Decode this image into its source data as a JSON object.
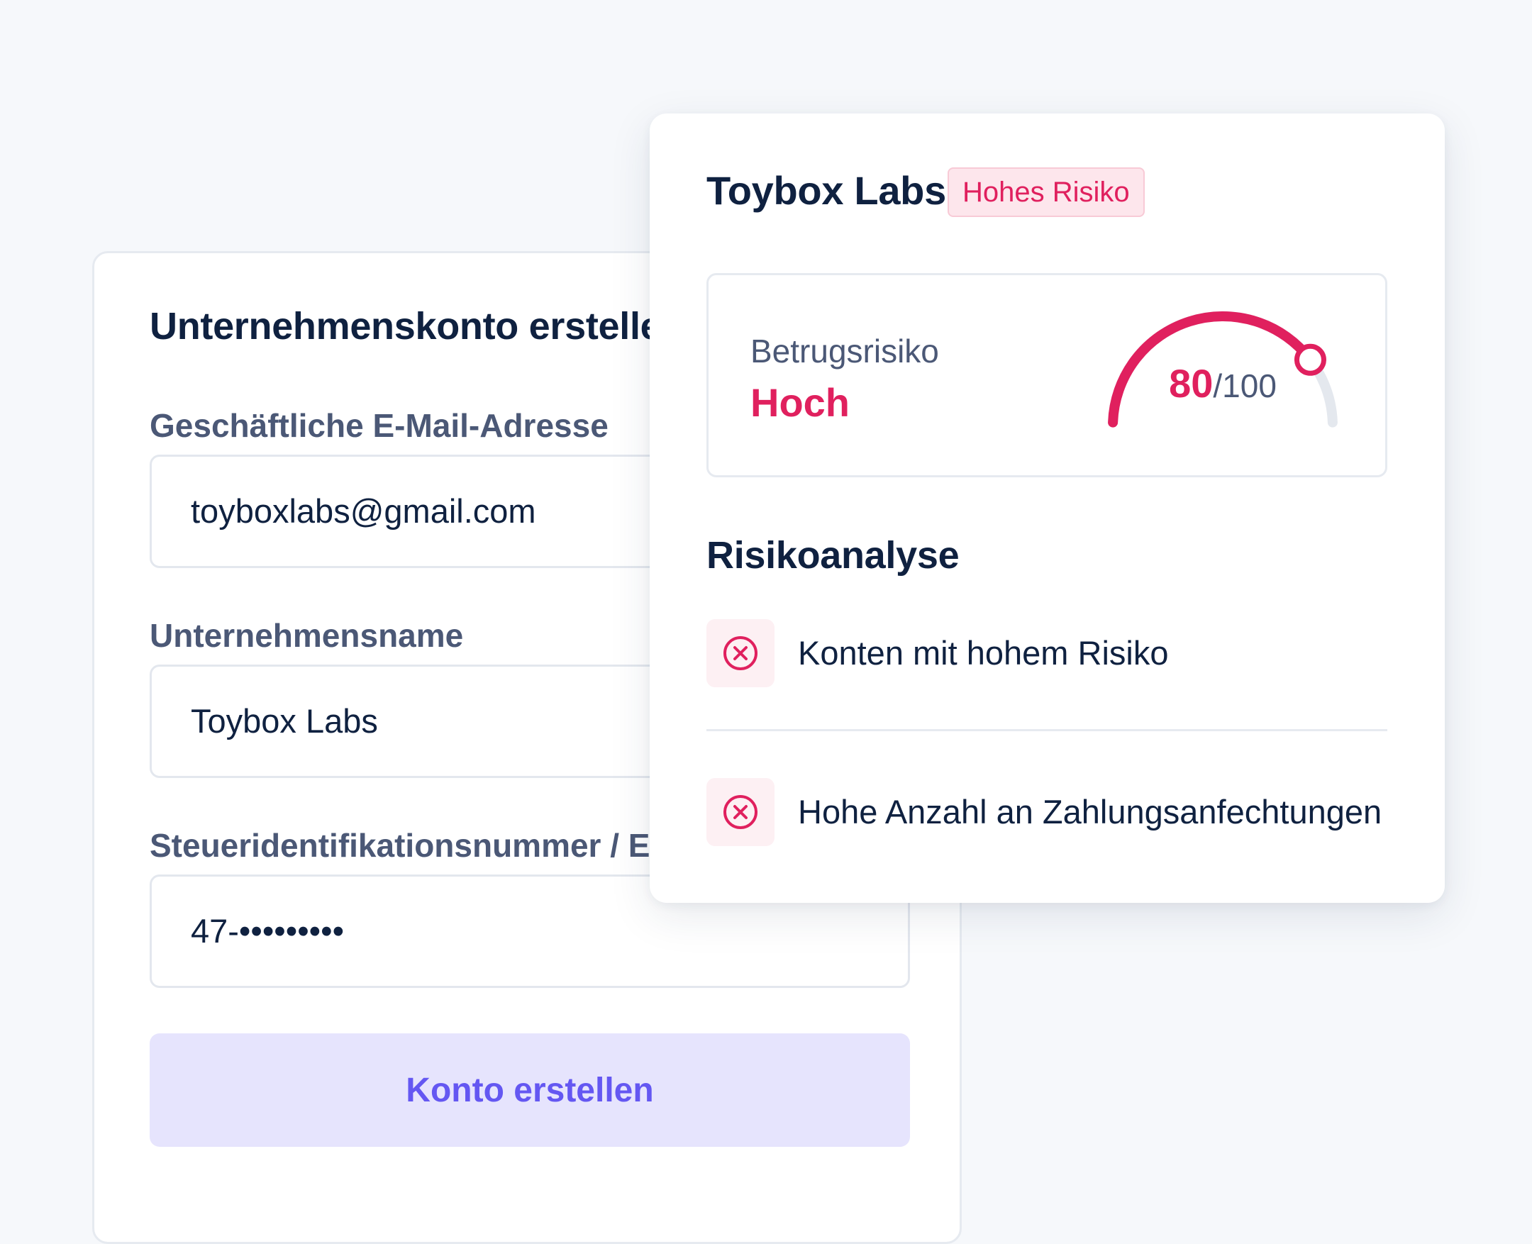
{
  "signup_form": {
    "title": "Unternehmenskonto erstellen",
    "email": {
      "label": "Geschäftliche E-Mail-Adresse",
      "value": "toyboxlabs@gmail.com"
    },
    "company_name": {
      "label": "Unternehmensname",
      "value": "Toybox Labs"
    },
    "tax_id": {
      "label": "Steueridentifikationsnummer / EIN",
      "value": "47-•••••••••"
    },
    "submit_label": "Konto erstellen"
  },
  "risk_card": {
    "company_name": "Toybox Labs",
    "badge": "Hohes Risiko",
    "score": {
      "label": "Betrugsrisiko",
      "level": "Hoch",
      "value": 80,
      "max_text": "/100",
      "max": 100
    },
    "analysis": {
      "title": "Risikoanalyse",
      "items": [
        {
          "text": "Konten mit hohem Risiko",
          "icon": "x-circle-icon"
        },
        {
          "text": "Hohe Anzahl an Zahlungsanfechtungen",
          "icon": "x-circle-icon"
        }
      ]
    }
  },
  "colors": {
    "background": "#f6f8fb",
    "danger": "#e0205e",
    "danger_soft": "#fde6ec",
    "primary": "#6457f2",
    "primary_soft": "#e6e4fd",
    "text": "#0f2140",
    "muted": "#4b5876",
    "gauge_track": "#e4e8ee"
  }
}
